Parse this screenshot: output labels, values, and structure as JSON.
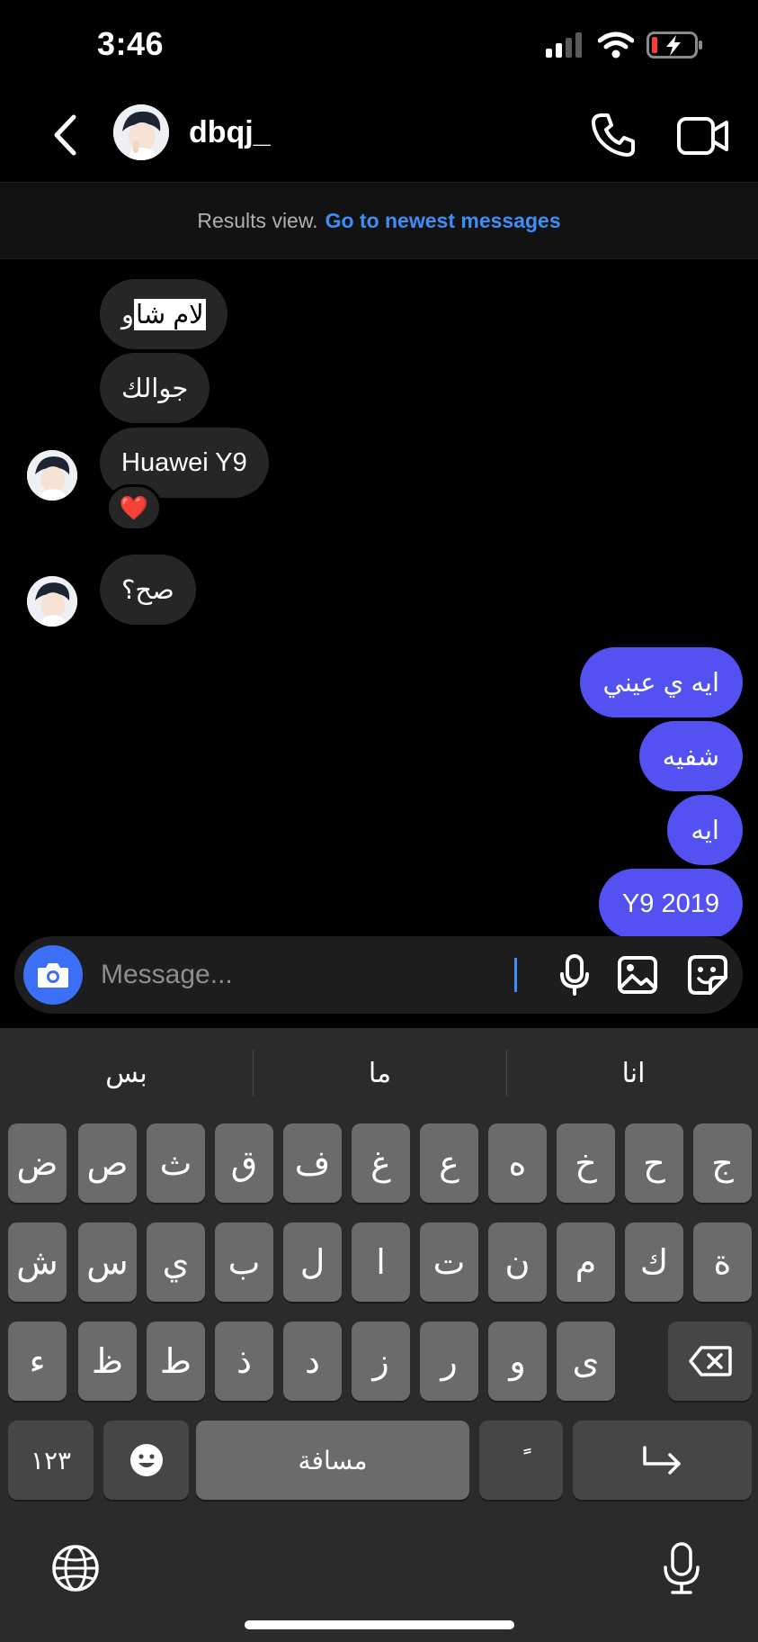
{
  "status_bar": {
    "time": "3:46"
  },
  "header": {
    "username": "dbqj_"
  },
  "banner": {
    "text": "Results view.",
    "link": "Go to newest messages"
  },
  "messages": {
    "incoming": [
      {
        "highlighted": "لام شا",
        "rest": "و"
      },
      {
        "text": "جوالك"
      },
      {
        "text": "Huawei Y9",
        "reaction": "❤️"
      },
      {
        "text": "صح؟"
      }
    ],
    "outgoing": [
      {
        "text": "ايه ي عيني"
      },
      {
        "text": "شفيه"
      },
      {
        "text": "ايه"
      },
      {
        "text": "Y9 2019"
      }
    ]
  },
  "composer": {
    "placeholder": "Message..."
  },
  "keyboard": {
    "suggestions": [
      "بس",
      "ما",
      "انا"
    ],
    "row1": [
      "ض",
      "ص",
      "ث",
      "ق",
      "ف",
      "غ",
      "ع",
      "ه",
      "خ",
      "ح",
      "ج"
    ],
    "row2": [
      "ش",
      "س",
      "ي",
      "ب",
      "ل",
      "ا",
      "ت",
      "ن",
      "م",
      "ك",
      "ة"
    ],
    "row3": [
      "ء",
      "ظ",
      "ط",
      "ذ",
      "د",
      "ز",
      "ر",
      "و",
      "ى"
    ],
    "numbers_label": "١٢٣",
    "space_label": "مسافة",
    "diacritic_label": "ًً",
    "emoji_icon": "emoji-icon",
    "return_icon": "return-icon"
  },
  "colors": {
    "outgoing_bubble": "#5351f2",
    "incoming_bubble": "#262626",
    "link": "#3e8ef7",
    "camera_button": "#3b6ff5"
  }
}
